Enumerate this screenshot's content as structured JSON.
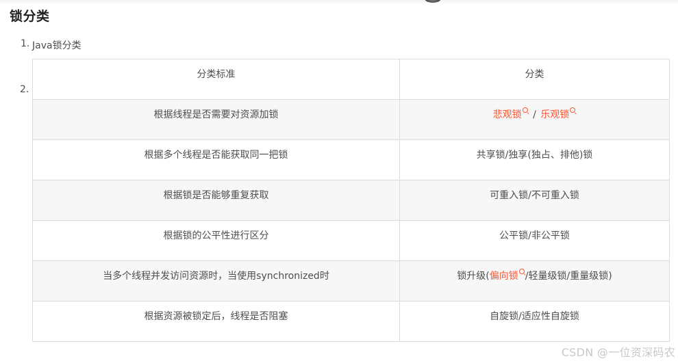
{
  "heading": "锁分类",
  "list": {
    "item1_marker": "1.",
    "item1_text": "Java锁分类",
    "item2_marker": "2."
  },
  "table": {
    "headers": [
      "分类标准",
      "分类"
    ],
    "rows": [
      {
        "criterion": "根据线程是否需要对资源加锁",
        "category_link_a": "悲观锁",
        "category_sep": "/",
        "category_link_b": "乐观锁"
      },
      {
        "criterion": "根据多个线程是否能获取同一把锁",
        "category": "共享锁/独享(独占、排他)锁"
      },
      {
        "criterion": "根据锁是否能够重复获取",
        "category": "可重入锁/不可重入锁"
      },
      {
        "criterion": "根据锁的公平性进行区分",
        "category": "公平锁/非公平锁"
      },
      {
        "criterion": "当多个线程并发访问资源时，当使用synchronized时",
        "category_prefix": "锁升级(",
        "category_link": "偏向锁",
        "category_suffix": "/轻量级锁/重量级锁)"
      },
      {
        "criterion": "根据资源被锁定后，线程是否阻塞",
        "category": "自旋锁/适应性自旋锁"
      }
    ]
  },
  "watermark": "CSDN @一位资深码农",
  "colors": {
    "link": "#fc5531",
    "text": "#4d4d4d",
    "row_shade": "#f7f7f7",
    "border": "#dcdcdc"
  },
  "icons": {
    "link_icon": "search-icon"
  }
}
